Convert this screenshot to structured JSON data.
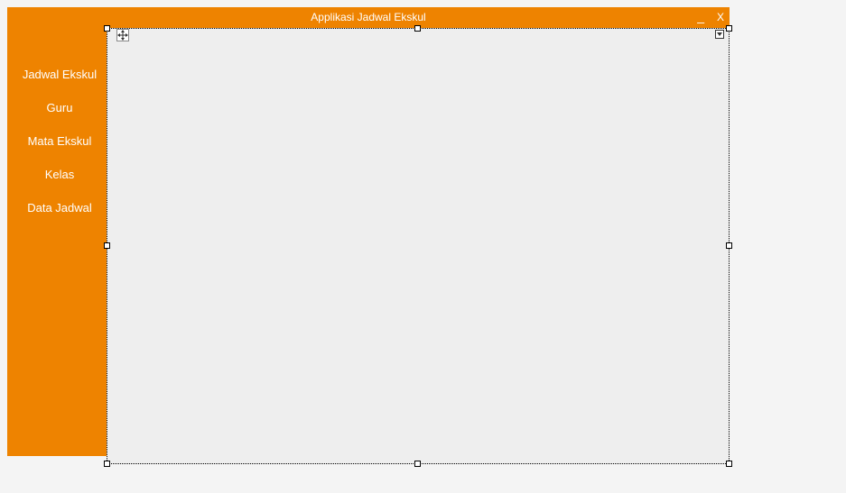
{
  "window": {
    "title": "Applikasi Jadwal Ekskul",
    "minimize_label": "_",
    "close_label": "X"
  },
  "sidebar": {
    "items": [
      {
        "label": "Jadwal Ekskul"
      },
      {
        "label": "Guru"
      },
      {
        "label": "Mata Ekskul"
      },
      {
        "label": "Kelas"
      },
      {
        "label": "Data Jadwal"
      }
    ]
  }
}
